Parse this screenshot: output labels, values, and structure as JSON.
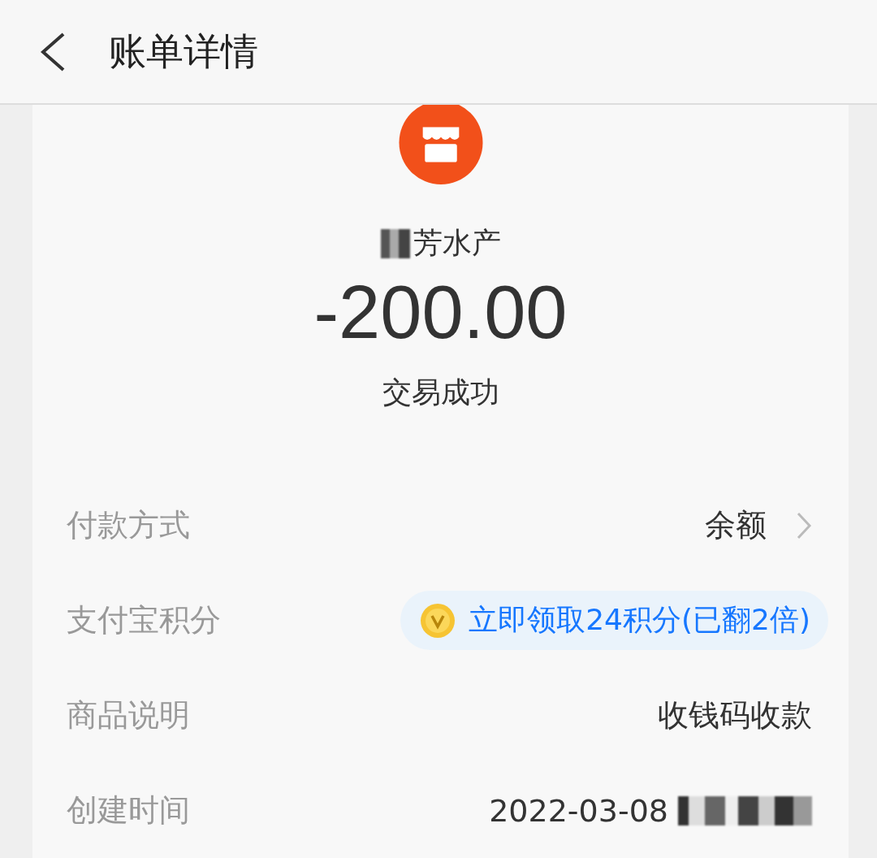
{
  "header": {
    "title": "账单详情"
  },
  "merchant": {
    "name": "芳水产",
    "redacted_prefix": true
  },
  "amount": "-200.00",
  "status": "交易成功",
  "rows": [
    {
      "kind": "link",
      "label": "付款方式",
      "value": "余额"
    },
    {
      "kind": "points",
      "label": "支付宝积分",
      "value": "立即领取24积分(已翻2倍)"
    },
    {
      "kind": "text",
      "label": "商品说明",
      "value": "收钱码收款"
    },
    {
      "kind": "text",
      "label": "创建时间",
      "value": "2022-03-08",
      "redacted_suffix": true
    }
  ]
}
